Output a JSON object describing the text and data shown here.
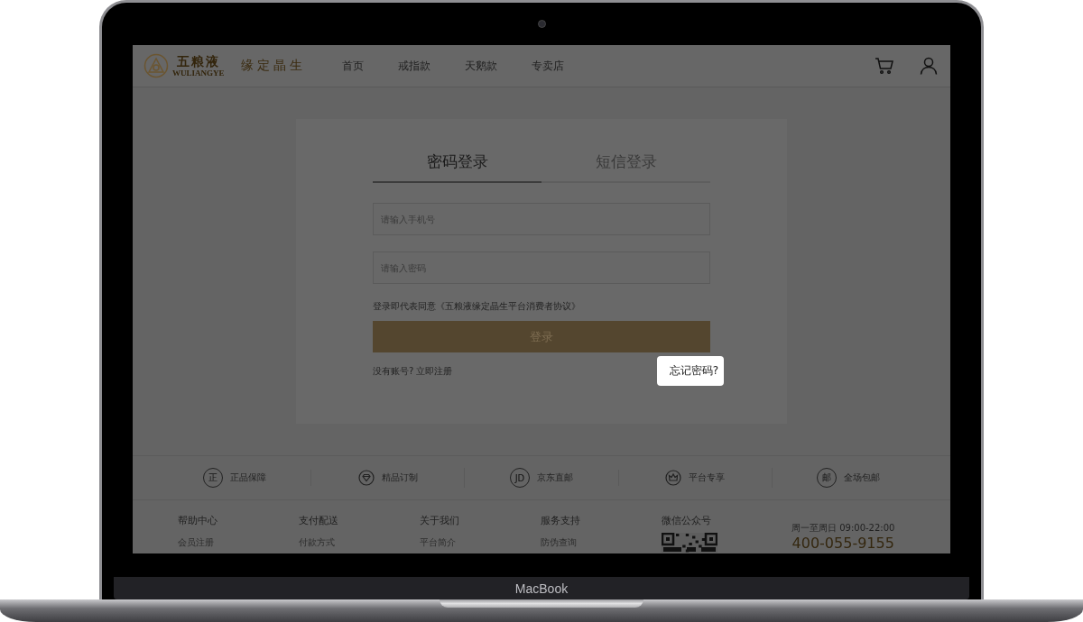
{
  "device": {
    "label": "MacBook"
  },
  "header": {
    "logo": {
      "text": "五粮液",
      "subtext": "WULIANGYE"
    },
    "slogan": "缘定晶生",
    "nav": [
      {
        "label": "首页"
      },
      {
        "label": "戒指款"
      },
      {
        "label": "天鹅款"
      },
      {
        "label": "专卖店"
      }
    ]
  },
  "login": {
    "tabs": [
      {
        "label": "密码登录",
        "selected": true
      },
      {
        "label": "短信登录",
        "selected": false
      }
    ],
    "fields": [
      {
        "placeholder": "请输入手机号"
      },
      {
        "placeholder": "请输入密码"
      }
    ],
    "agreement": "登录即代表同意《五粮液缘定晶生平台消费者协议》",
    "submit": "登录",
    "register": {
      "prompt": "没有账号?",
      "link": "立即注册"
    },
    "forgot": {
      "label": "忘记密码?",
      "highlighted": true
    }
  },
  "features": [
    {
      "kind": "glyph",
      "glyph": "正",
      "label": "正品保障"
    },
    {
      "kind": "diamond",
      "label": "精品订制"
    },
    {
      "kind": "glyph",
      "glyph": "JD",
      "label": "京东直邮"
    },
    {
      "kind": "crown",
      "label": "平台专享"
    },
    {
      "kind": "glyph",
      "glyph": "邮",
      "label": "全场包邮"
    }
  ],
  "footer": {
    "columns": [
      {
        "title": "帮助中心",
        "links": [
          "会员注册"
        ]
      },
      {
        "title": "支付配送",
        "links": [
          "付款方式"
        ]
      },
      {
        "title": "关于我们",
        "links": [
          "平台简介"
        ]
      },
      {
        "title": "服务支持",
        "links": [
          "防伪查询"
        ]
      }
    ],
    "wechat": {
      "title": "微信公众号"
    },
    "hours": "周一至周日 09:00-22:00",
    "phone": "400-055-9155"
  }
}
